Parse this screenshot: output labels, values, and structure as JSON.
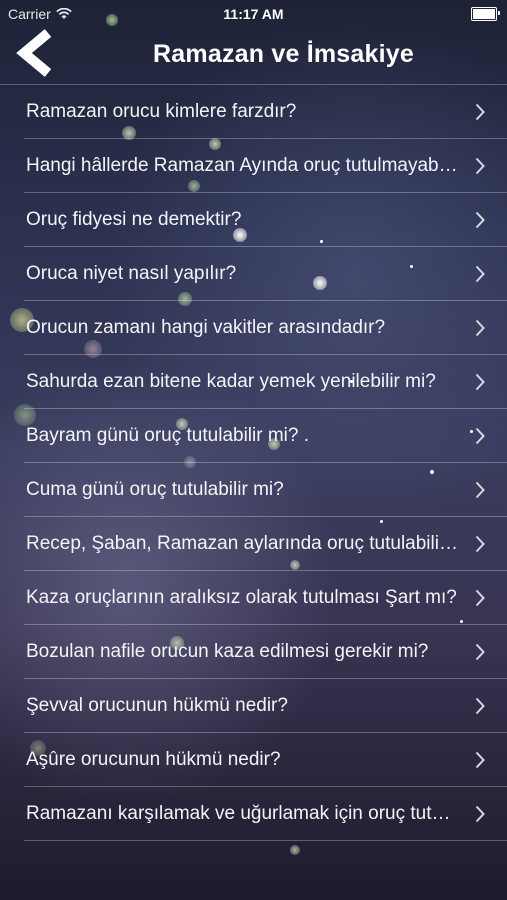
{
  "status_bar": {
    "carrier": "Carrier",
    "time": "11:17 AM"
  },
  "nav": {
    "title": "Ramazan ve İmsakiye",
    "back_icon": "chevron-left-icon"
  },
  "list": {
    "items": [
      {
        "label": "Ramazan orucu kimlere farzdır?"
      },
      {
        "label": "Hangi hâllerde Ramazan Ayında oruç tutulmayabilir?"
      },
      {
        "label": "Oruç fidyesi ne demektir?"
      },
      {
        "label": "Oruca niyet nasıl yapılır?"
      },
      {
        "label": "Orucun zamanı hangi vakitler arasındadır?"
      },
      {
        "label": "Sahurda ezan bitene kadar yemek yenilebilir mi?"
      },
      {
        "label": "Bayram günü oruç tutulabilir mi? ."
      },
      {
        "label": "Cuma günü oruç tutulabilir mi?"
      },
      {
        "label": "Recep, Şaban, Ramazan aylarında oruç tutulabilir mi?"
      },
      {
        "label": "Kaza oruçlarının aralıksız olarak tutulması Şart mı?"
      },
      {
        "label": "Bozulan nafile orucun kaza edilmesi gerekir mi?"
      },
      {
        "label": "Şevval orucunun hükmü nedir?"
      },
      {
        "label": "Aşûre orucunun hükmü nedir?"
      },
      {
        "label": "Ramazanı karşılamak ve uğurlamak için oruç tutulur mu?"
      }
    ],
    "row_icon": "chevron-right-icon"
  }
}
